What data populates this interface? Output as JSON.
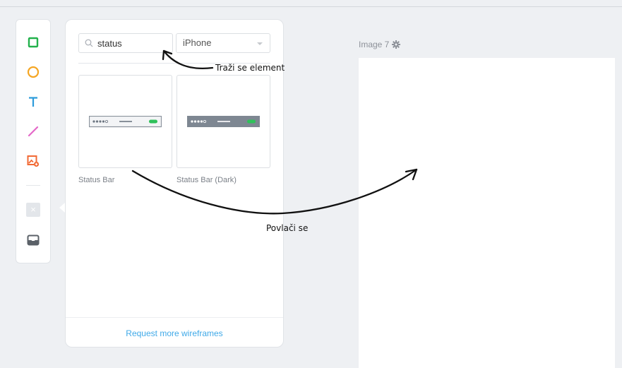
{
  "toolbar": {
    "tools": [
      {
        "name": "rectangle-tool",
        "icon": "square-icon",
        "color": "#22b14c"
      },
      {
        "name": "ellipse-tool",
        "icon": "circle-icon",
        "color": "#f5a623"
      },
      {
        "name": "text-tool",
        "icon": "text-icon",
        "color": "#2d9cdb"
      },
      {
        "name": "line-tool",
        "icon": "line-icon",
        "color": "#e468c8"
      },
      {
        "name": "image-tool",
        "icon": "image-icon",
        "color": "#f26a35"
      },
      {
        "name": "delete-tool",
        "icon": "close-icon",
        "color": "#d5d9de"
      },
      {
        "name": "library-tool",
        "icon": "inbox-icon",
        "color": "#5b6168"
      }
    ],
    "delete_symbol": "×"
  },
  "library": {
    "search": {
      "value": "status",
      "placeholder": "Search"
    },
    "device": {
      "selected": "iPhone"
    },
    "items": [
      {
        "label": "Status Bar"
      },
      {
        "label": "Status Bar (Dark)"
      }
    ],
    "request_link": "Request more wireframes"
  },
  "canvas": {
    "title": "Image 7"
  },
  "annotations": {
    "search": "Traži se element",
    "drag": "Povlači se"
  },
  "colors": {
    "accent": "#3fa9e8",
    "status_green": "#2fc15a",
    "dark_bar": "#7e8792"
  }
}
